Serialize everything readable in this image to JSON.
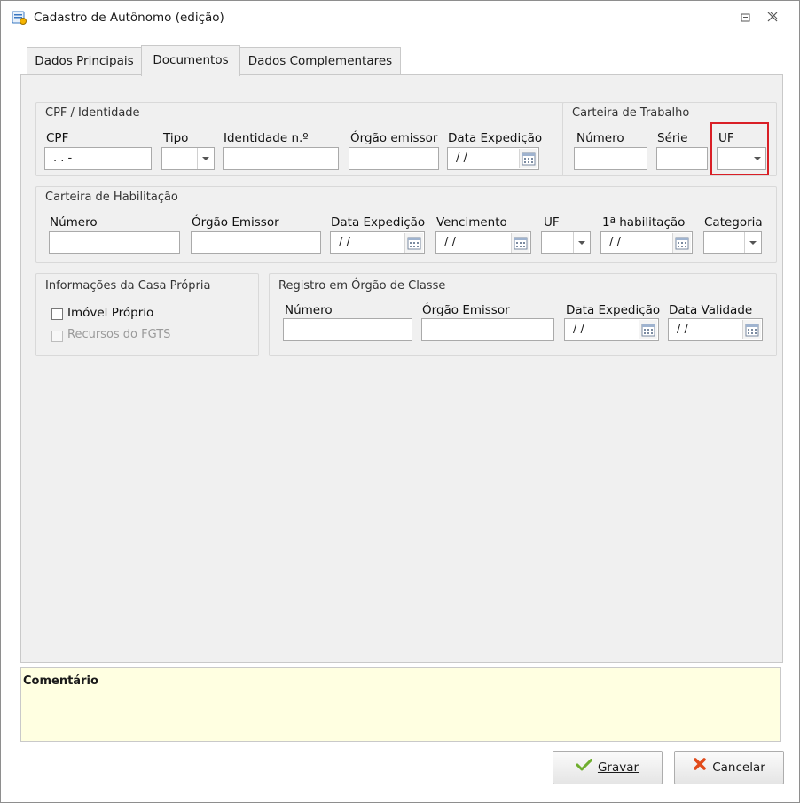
{
  "window": {
    "title": "Cadastro de Autônomo (edição)"
  },
  "tabs": [
    {
      "label": "Dados Principais"
    },
    {
      "label": "Documentos"
    },
    {
      "label": "Dados Complementares"
    }
  ],
  "active_tab": "Documentos",
  "cpf_identidade": {
    "title": "CPF / Identidade",
    "cpf_label": "CPF",
    "cpf_value": " .   .   -",
    "tipo_label": "Tipo",
    "identidade_label": "Identidade n.º",
    "orgao_label": "Órgão emissor",
    "data_label": "Data Expedição",
    "data_value": "/ /"
  },
  "carteira_trabalho": {
    "title": "Carteira de Trabalho",
    "numero_label": "Número",
    "serie_label": "Série",
    "uf_label": "UF"
  },
  "carteira_habilitacao": {
    "title": "Carteira de Habilitação",
    "numero_label": "Número",
    "orgao_label": "Órgão Emissor",
    "data_label": "Data Expedição",
    "data_value": "/ /",
    "vencimento_label": "Vencimento",
    "vencimento_value": "/ /",
    "uf_label": "UF",
    "primeira_label": "1ª habilitação",
    "primeira_value": "/ /",
    "categoria_label": "Categoria"
  },
  "casa_propria": {
    "title": "Informações da Casa Própria",
    "imovel_label": "Imóvel Próprio",
    "fgts_label": "Recursos do FGTS"
  },
  "orgao_classe": {
    "title": "Registro em Órgão de Classe",
    "numero_label": "Número",
    "orgao_label": "Órgão Emissor",
    "data_label": "Data Expedição",
    "data_value": "/ /",
    "validade_label": "Data Validade",
    "validade_value": "/ /"
  },
  "comment": {
    "label": "Comentário"
  },
  "buttons": {
    "save_label": "Gravar",
    "cancel_label": "Cancelar"
  },
  "colors": {
    "highlight": "#d91f26",
    "comment_bg": "#ffffe1",
    "panel_bg": "#f0f0f0"
  }
}
